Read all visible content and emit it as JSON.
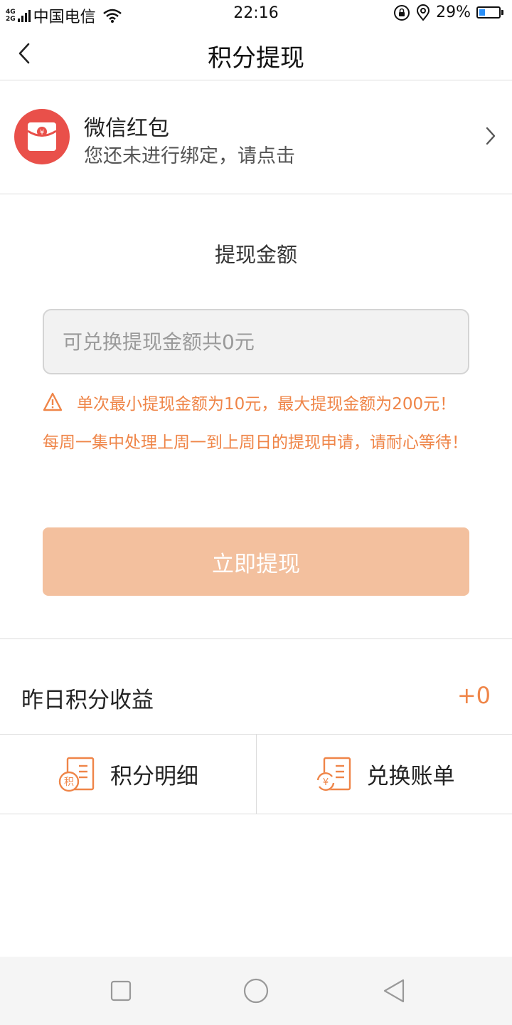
{
  "status_bar": {
    "net_top": "4G",
    "net_bottom": "2G",
    "carrier": "中国电信",
    "time": "22:16",
    "battery_percent": "29%",
    "battery_level": 0.29
  },
  "nav": {
    "title": "积分提现",
    "back_icon": "chevron-left-icon"
  },
  "wechat": {
    "title": "微信红包",
    "subtitle": "您还未进行绑定，请点击",
    "icon_symbol": "¥"
  },
  "withdraw": {
    "amount_label": "提现金额",
    "input_placeholder": "可兑换提现金额共0元",
    "input_value": "",
    "warning": "单次最小提现金额为10元，最大提现金额为200元！",
    "notice": "每周一集中处理上周一到上周日的提现申请，请耐心等待！",
    "submit_label": "立即提现"
  },
  "earnings": {
    "label": "昨日积分收益",
    "value": "+0"
  },
  "actions": [
    {
      "label": "积分明细",
      "icon": "points-detail-icon",
      "icon_char": "积"
    },
    {
      "label": "兑换账单",
      "icon": "exchange-bill-icon",
      "icon_char": "¥"
    }
  ],
  "colors": {
    "accent": "#ef8548",
    "button_disabled": "#f3c09e",
    "redpack": "#e9504a",
    "battery": "#2a8ff7"
  }
}
